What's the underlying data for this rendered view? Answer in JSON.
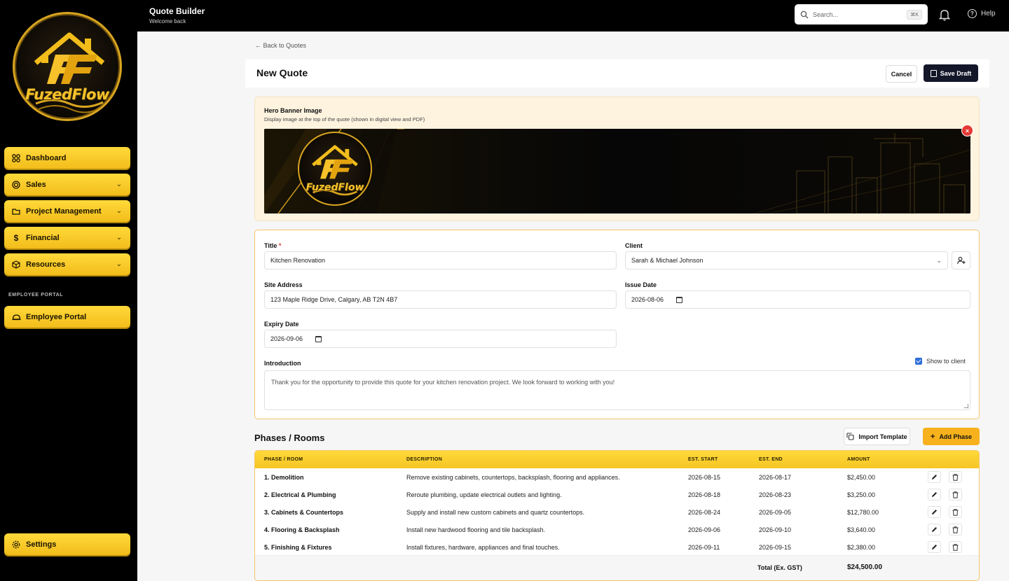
{
  "brand": {
    "logo_text": "FuzedFlow",
    "accent": "#f5c524",
    "dark": "#14172a"
  },
  "sidebar": {
    "items": [
      {
        "label": "Dashboard",
        "icon": "grid-icon",
        "chevron": false
      },
      {
        "label": "Sales",
        "icon": "target-icon",
        "chevron": true
      },
      {
        "label": "Project Management",
        "icon": "folder-icon",
        "chevron": true
      },
      {
        "label": "Financial",
        "icon": "dollar-icon",
        "chevron": true
      },
      {
        "label": "Resources",
        "icon": "cube-icon",
        "chevron": true
      }
    ],
    "section_label": "EMPLOYEE PORTAL",
    "portal_item": "Employee Portal",
    "settings_item": "Settings"
  },
  "topbar": {
    "title": "Quote Builder",
    "subtitle": "Welcome back",
    "search_placeholder": "Search...",
    "search_shortcut": "⌘K",
    "help_label": "Help"
  },
  "page": {
    "back_link": "Back to Quotes",
    "title": "New Quote",
    "cancel_label": "Cancel",
    "save_label": "Save Draft"
  },
  "hero": {
    "title": "Hero Banner Image",
    "subtitle": "Display image at the top of the quote (shown in digital view and PDF)",
    "logo_text": "FuzedFlow"
  },
  "form": {
    "title_label": "Title",
    "title_value": "Kitchen Renovation",
    "client_label": "Client",
    "client_value": "Sarah & Michael Johnson",
    "site_label": "Site Address",
    "site_value": "123 Maple Ridge Drive, Calgary, AB T2N 4B7",
    "issue_label": "Issue Date",
    "issue_value": "2026-08-06",
    "expiry_label": "Expiry Date",
    "expiry_value": "2026-09-06",
    "intro_label": "Introduction",
    "show_client_label": "Show to client",
    "intro_value": "Thank you for the opportunity to provide this quote for your kitchen renovation project. We look forward to working with you!"
  },
  "phases": {
    "title": "Phases / Rooms",
    "import_label": "Import Template",
    "add_label": "Add Phase",
    "headers": [
      "PHASE / ROOM",
      "DESCRIPTION",
      "EST. START",
      "EST. END",
      "AMOUNT"
    ],
    "rows": [
      {
        "name": "1. Demolition",
        "description": "Remove existing cabinets, countertops, backsplash, flooring and appliances.",
        "start": "2026-08-15",
        "end": "2026-08-17",
        "amount": "$2,450.00"
      },
      {
        "name": "2. Electrical & Plumbing",
        "description": "Reroute plumbing, update electrical outlets and lighting.",
        "start": "2026-08-18",
        "end": "2026-08-23",
        "amount": "$3,250.00"
      },
      {
        "name": "3. Cabinets & Countertops",
        "description": "Supply and install new custom cabinets and quartz countertops.",
        "start": "2026-08-24",
        "end": "2026-09-05",
        "amount": "$12,780.00"
      },
      {
        "name": "4. Flooring & Backsplash",
        "description": "Install new hardwood flooring and tile backsplash.",
        "start": "2026-09-06",
        "end": "2026-09-10",
        "amount": "$3,640.00"
      },
      {
        "name": "5. Finishing & Fixtures",
        "description": "Install fixtures, hardware, appliances and final touches.",
        "start": "2026-09-11",
        "end": "2026-09-15",
        "amount": "$2,380.00"
      }
    ],
    "total_label": "Total (Ex. GST)",
    "total_value": "$24,500.00"
  }
}
